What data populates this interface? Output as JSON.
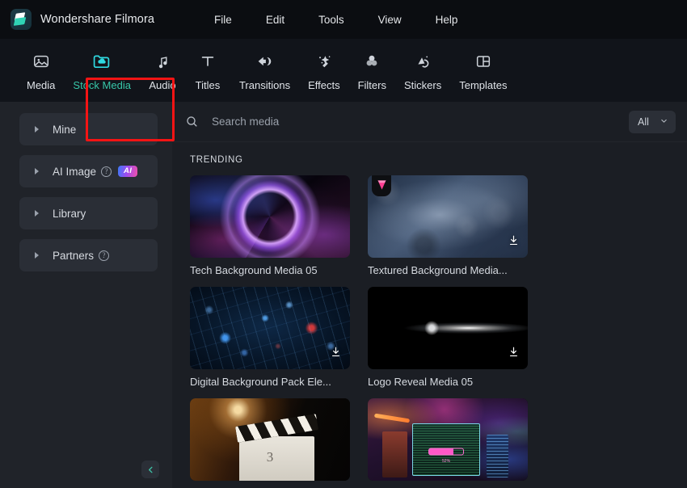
{
  "window": {
    "app_title": "Wondershare Filmora",
    "logo_icon": "filmora-logo-icon",
    "menu": [
      {
        "label": "File"
      },
      {
        "label": "Edit"
      },
      {
        "label": "Tools"
      },
      {
        "label": "View"
      },
      {
        "label": "Help"
      }
    ]
  },
  "tabs": {
    "active": "Stock Media",
    "items": [
      {
        "label": "Media",
        "icon": "media-image-icon"
      },
      {
        "label": "Stock Media",
        "icon": "stock-media-cloud-folder-icon"
      },
      {
        "label": "Audio",
        "icon": "audio-note-icon"
      },
      {
        "label": "Titles",
        "icon": "titles-text-icon"
      },
      {
        "label": "Transitions",
        "icon": "transitions-arrows-icon"
      },
      {
        "label": "Effects",
        "icon": "effects-wand-icon"
      },
      {
        "label": "Filters",
        "icon": "filters-circles-icon"
      },
      {
        "label": "Stickers",
        "icon": "stickers-icon"
      },
      {
        "label": "Templates",
        "icon": "templates-layout-icon"
      }
    ]
  },
  "annotation": {
    "target": "Stock Media",
    "color": "#f51414"
  },
  "sidebar": {
    "items": [
      {
        "label": "Mine",
        "has_help": false,
        "has_ai_badge": false
      },
      {
        "label": "AI Image",
        "has_help": true,
        "has_ai_badge": true,
        "ai_badge_text": "AI"
      },
      {
        "label": "Library",
        "has_help": false,
        "has_ai_badge": false
      },
      {
        "label": "Partners",
        "has_help": true,
        "has_ai_badge": false
      }
    ],
    "collapse_icon": "chevron-left-icon",
    "collapse_color": "#3ec4a8"
  },
  "search": {
    "icon": "search-icon",
    "value": "",
    "placeholder": "Search media",
    "filter": {
      "value": "All",
      "chevron": "chevron-down-icon"
    }
  },
  "content": {
    "section_title": "TRENDING",
    "cards": [
      {
        "title": "Tech Background Media 05",
        "art": "neonring",
        "premium": false,
        "download": false
      },
      {
        "title": "Textured Background Media...",
        "art": "texture",
        "premium": true,
        "download": true
      },
      {
        "title": "Digital Background Pack Ele...",
        "art": "digital",
        "premium": false,
        "download": true
      },
      {
        "title": "Logo Reveal Media 05",
        "art": "logoreveal",
        "premium": false,
        "download": true
      },
      {
        "title": "",
        "art": "clapper",
        "premium": false,
        "download": false
      },
      {
        "title": "",
        "art": "workspace",
        "premium": false,
        "download": false
      }
    ],
    "download_icon": "download-arrow-icon",
    "premium_icon": "premium-gem-icon"
  },
  "colors": {
    "titlebar_bg": "#0b0d11",
    "tabbar_bg": "#11141a",
    "sidebar_bg": "#202329",
    "main_bg": "#1b1e24",
    "accent_teal": "#2fd9e0",
    "accent_green": "#37c6a8",
    "annotation_red": "#f51414"
  }
}
